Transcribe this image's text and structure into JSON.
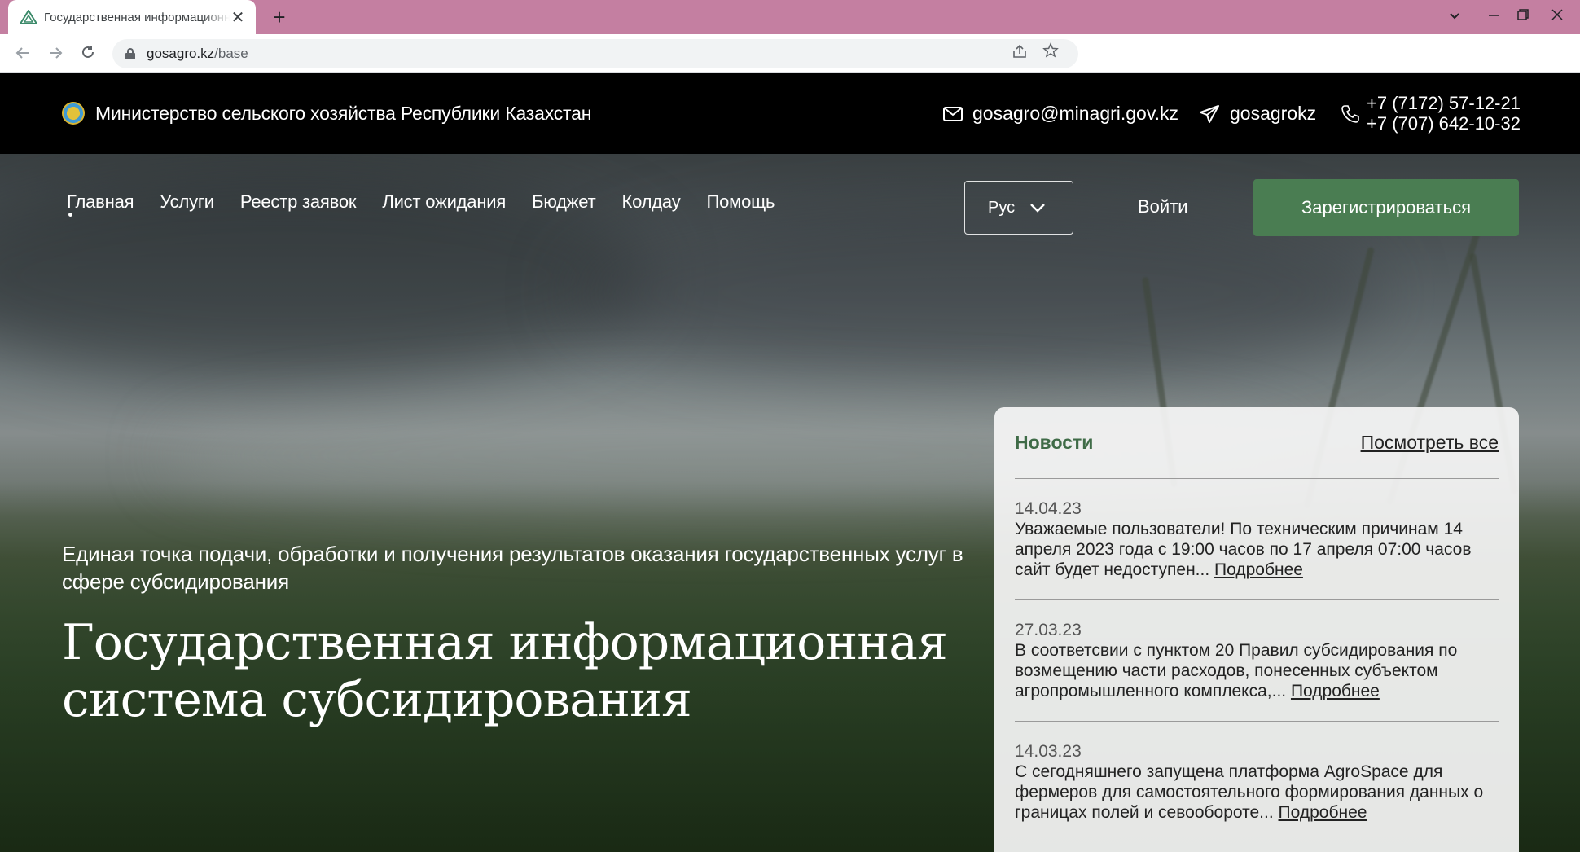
{
  "browser": {
    "tab_title": "Государственная информационная система субсидирования",
    "url_host": "gosagro.kz",
    "url_path": "/base",
    "new_tab": "+",
    "close": "✕"
  },
  "topbar": {
    "ministry": "Министерство сельского хозяйства Республики Казахстан",
    "email": "gosagro@minagri.gov.kz",
    "telegram": "gosagrokz",
    "phone1": "+7 (7172) 57-12-21",
    "phone2": "+7 (707) 642-10-32"
  },
  "nav": {
    "items": [
      "Главная",
      "Услуги",
      "Реестр заявок",
      "Лист ожидания",
      "Бюджет",
      "Колдау",
      "Помощь"
    ],
    "lang": "Рус",
    "login": "Войти",
    "register": "Зарегистрироваться"
  },
  "hero": {
    "subtitle": "Единая точка подачи, обработки и получения результатов оказания государственных услуг в сфере субсидирования",
    "title_line1": "Государственная информационная",
    "title_line2": "система субсидирования"
  },
  "news": {
    "title": "Новости",
    "view_all": "Посмотреть все",
    "more_label": "Подробнее",
    "items": [
      {
        "date": "14.04.23",
        "text": "Уважаемые пользователи! По техническим причинам 14 апреля 2023 года с 19:00 часов по 17 апреля 07:00 часов сайт будет недоступен... "
      },
      {
        "date": "27.03.23",
        "text": "В соответсвии с пунктом 20 Правил субсидирования по возмещению части расходов, понесенных субъектом агропромышленного комплекса,... "
      },
      {
        "date": "14.03.23",
        "text": "С сегодняшнего запущена платформа AgroSpace для фермеров для самостоятельного формирования данных о границах полей и севообороте... "
      }
    ]
  },
  "colors": {
    "tabstrip": "#c47fa1",
    "accent_green": "#4a7d52",
    "news_title": "#3f6b47"
  }
}
